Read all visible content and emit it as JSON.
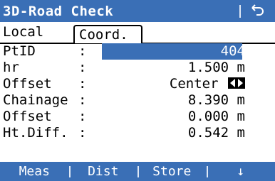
{
  "window": {
    "title": "3D-Road Check",
    "back_icon": "return-arrow-icon"
  },
  "tabs": [
    {
      "label": "Local",
      "active": true
    },
    {
      "label": "Coord.",
      "active": false
    }
  ],
  "fields": [
    {
      "label": "PtID",
      "colon": ":",
      "value": "404",
      "highlighted": true
    },
    {
      "label": "hr",
      "colon": ":",
      "value": "1.500 m"
    },
    {
      "label": "Offset",
      "colon": ":",
      "value": "Center",
      "icon": "left-right-arrows-icon"
    },
    {
      "label": "Chainage",
      "colon": ":",
      "value": "8.390 m"
    },
    {
      "label": "Offset",
      "colon": ":",
      "value": "0.000 m"
    },
    {
      "label": "Ht.Diff.",
      "colon": ":",
      "value": "0.542 m"
    }
  ],
  "softkeys": [
    {
      "label": "Meas"
    },
    {
      "label": "Dist"
    },
    {
      "label": "Store"
    },
    {
      "label": "↓",
      "icon": "arrow-down-icon"
    }
  ],
  "colors": {
    "accent": "#3a6fb6",
    "text": "#000000",
    "background": "#ffffff"
  }
}
